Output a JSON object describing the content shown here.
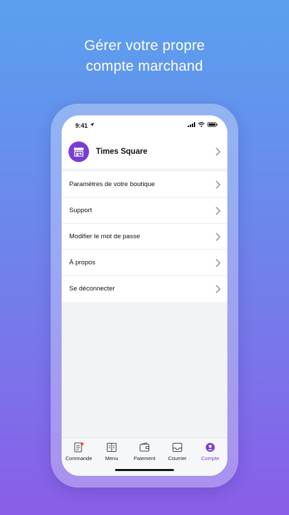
{
  "headline": {
    "line1": "Gérer votre propre",
    "line2": "compte marchand"
  },
  "status": {
    "time": "9:41"
  },
  "store": {
    "name": "Times Square"
  },
  "menu": [
    {
      "label": "Paramètres de votre boutique"
    },
    {
      "label": "Support"
    },
    {
      "label": "Modifier le mot de passe"
    },
    {
      "label": "À propos"
    },
    {
      "label": "Se déconnecter"
    }
  ],
  "tabs": [
    {
      "label": "Commande",
      "icon": "order-icon",
      "badge": true
    },
    {
      "label": "Menu",
      "icon": "book-icon"
    },
    {
      "label": "Paiement",
      "icon": "wallet-icon"
    },
    {
      "label": "Courrier",
      "icon": "inbox-icon"
    },
    {
      "label": "Compte",
      "icon": "account-icon",
      "active": true
    }
  ],
  "colors": {
    "accent": "#7a3cd6",
    "badge": "#f0483e",
    "background_top": "#5aa0ee",
    "background_bottom": "#8a5ee8"
  }
}
